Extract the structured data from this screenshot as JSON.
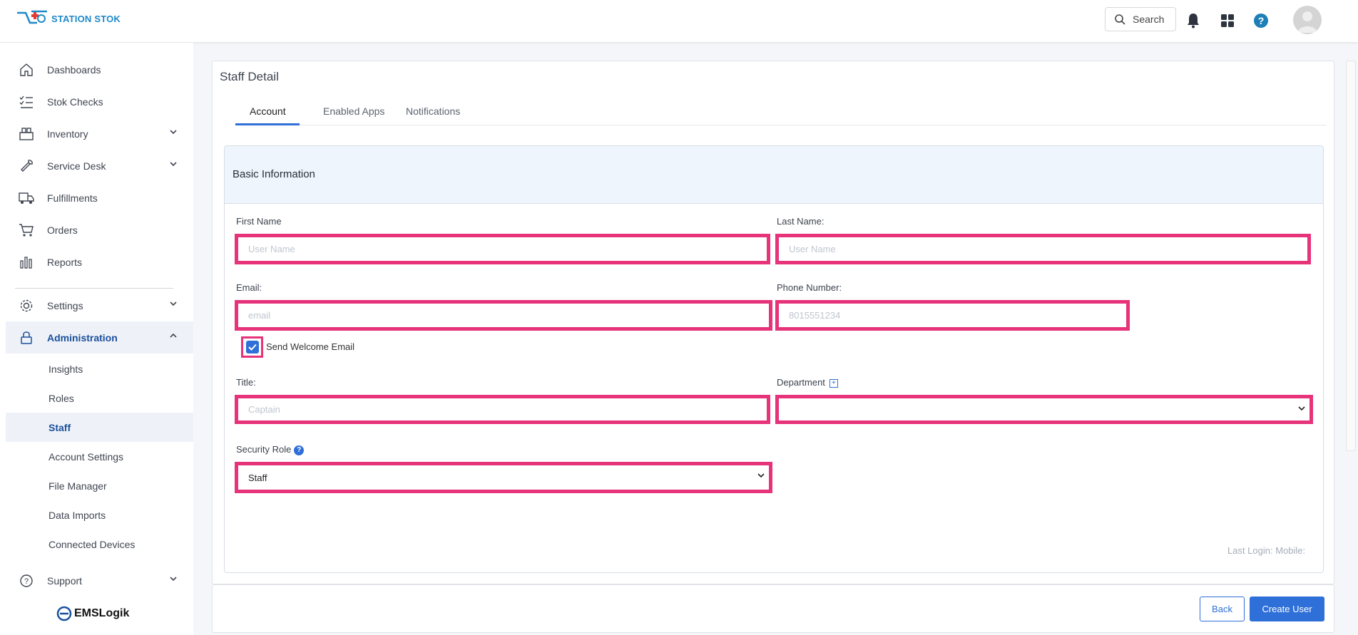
{
  "brand": {
    "name": "STATION STOK",
    "footer_brand": "EMSLogik",
    "accent": "#2f6fd8",
    "highlight": "#e6337a"
  },
  "header": {
    "search_label": "Search",
    "icons": [
      "search-icon",
      "bell-icon",
      "apps-grid-icon",
      "help-icon",
      "avatar"
    ]
  },
  "sidebar": {
    "items": [
      {
        "label": "Dashboards",
        "icon": "home-icon"
      },
      {
        "label": "Stok Checks",
        "icon": "checklist-icon"
      },
      {
        "label": "Inventory",
        "icon": "boxes-icon"
      },
      {
        "label": "Service Desk",
        "icon": "wrench-icon"
      },
      {
        "label": "Fulfillments",
        "icon": "truck-icon"
      },
      {
        "label": "Orders",
        "icon": "cart-icon"
      },
      {
        "label": "Reports",
        "icon": "bar-chart-icon"
      },
      {
        "label": "Settings",
        "icon": "gear-icon"
      },
      {
        "label": "Administration",
        "icon": "lock-icon"
      },
      {
        "label": "Support",
        "icon": "question-circle-icon"
      }
    ],
    "admin_subitems": [
      {
        "label": "Insights"
      },
      {
        "label": "Roles"
      },
      {
        "label": "Staff"
      },
      {
        "label": "Account Settings"
      },
      {
        "label": "File Manager"
      },
      {
        "label": "Data Imports"
      },
      {
        "label": "Connected Devices"
      }
    ]
  },
  "page": {
    "title": "Staff Detail",
    "tabs": [
      {
        "label": "Account"
      },
      {
        "label": "Enabled Apps"
      },
      {
        "label": "Notifications"
      }
    ],
    "section_title": "Basic Information",
    "form": {
      "first_name": {
        "label": "First Name",
        "placeholder": "User Name",
        "value": ""
      },
      "last_name": {
        "label": "Last Name:",
        "placeholder": "User Name",
        "value": ""
      },
      "email": {
        "label": "Email:",
        "placeholder": "email",
        "value": ""
      },
      "phone": {
        "label": "Phone Number:",
        "placeholder": "8015551234",
        "value": ""
      },
      "welcome_email": {
        "label": "Send Welcome Email",
        "checked": true
      },
      "title": {
        "label": "Title:",
        "placeholder": "Captain",
        "value": ""
      },
      "department": {
        "label": "Department",
        "value": ""
      },
      "security_role": {
        "label": "Security Role",
        "value": "Staff"
      }
    },
    "last_login": "Last Login: Mobile:"
  },
  "footer": {
    "back_label": "Back",
    "create_label": "Create User"
  }
}
